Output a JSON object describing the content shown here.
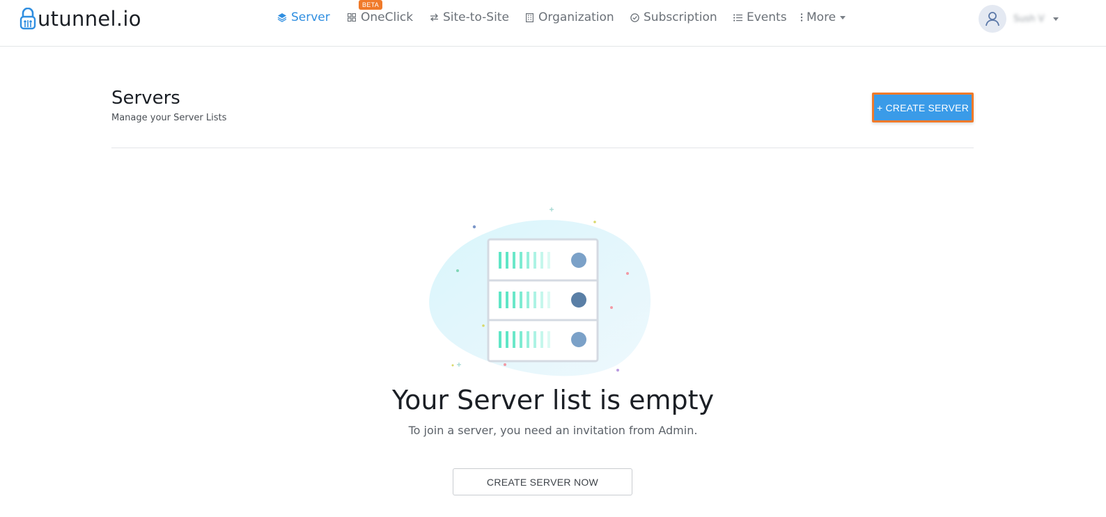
{
  "brand": {
    "name": "utunnel.io"
  },
  "nav": {
    "items": [
      {
        "label": "Server",
        "icon": "layers-icon",
        "active": true
      },
      {
        "label": "OneClick",
        "icon": "grid-icon",
        "badge": "BETA"
      },
      {
        "label": "Site-to-Site",
        "icon": "arrows-swap-icon"
      },
      {
        "label": "Organization",
        "icon": "building-icon"
      },
      {
        "label": "Subscription",
        "icon": "check-circle-icon"
      },
      {
        "label": "Events",
        "icon": "list-icon"
      },
      {
        "label": "More",
        "icon": "vertical-dots-icon"
      }
    ]
  },
  "user": {
    "name": "Sush V"
  },
  "page": {
    "title": "Servers",
    "subtitle": "Manage your Server Lists",
    "create_button": "+ CREATE SERVER"
  },
  "empty_state": {
    "title": "Your Server list is empty",
    "text": "To join a server, you need an invitation from Admin.",
    "button": "CREATE SERVER NOW"
  },
  "colors": {
    "accent": "#3a9be8",
    "highlight": "#f07a2a",
    "active_nav": "#2f8ee0"
  }
}
